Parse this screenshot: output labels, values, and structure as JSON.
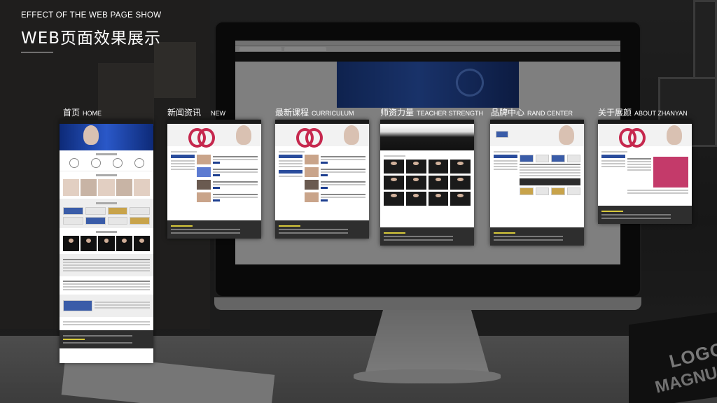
{
  "header": {
    "eyebrow": "EFFECT OF THE WEB PAGE SHOW",
    "title": "WEB页面效果展示"
  },
  "sections": [
    {
      "zh": "首页",
      "en": "HOME"
    },
    {
      "zh": "新闻资讯",
      "en": "NEW"
    },
    {
      "zh": "最新课程",
      "en": "CURRICULUM"
    },
    {
      "zh": "师资力量",
      "en": "TEACHER STRENGTH"
    },
    {
      "zh": "品牌中心",
      "en": "RAND CENTER"
    },
    {
      "zh": "关于展颜",
      "en": "ABOUT ZHANYAN"
    }
  ],
  "background": {
    "books": [
      "LOGOS",
      "MAGNU"
    ]
  },
  "colors": {
    "banner_blue": "#2a58c8",
    "logo_pink": "#c6284e",
    "footer_dark": "#2e2e2e",
    "footer_accent": "#d7c93a"
  }
}
